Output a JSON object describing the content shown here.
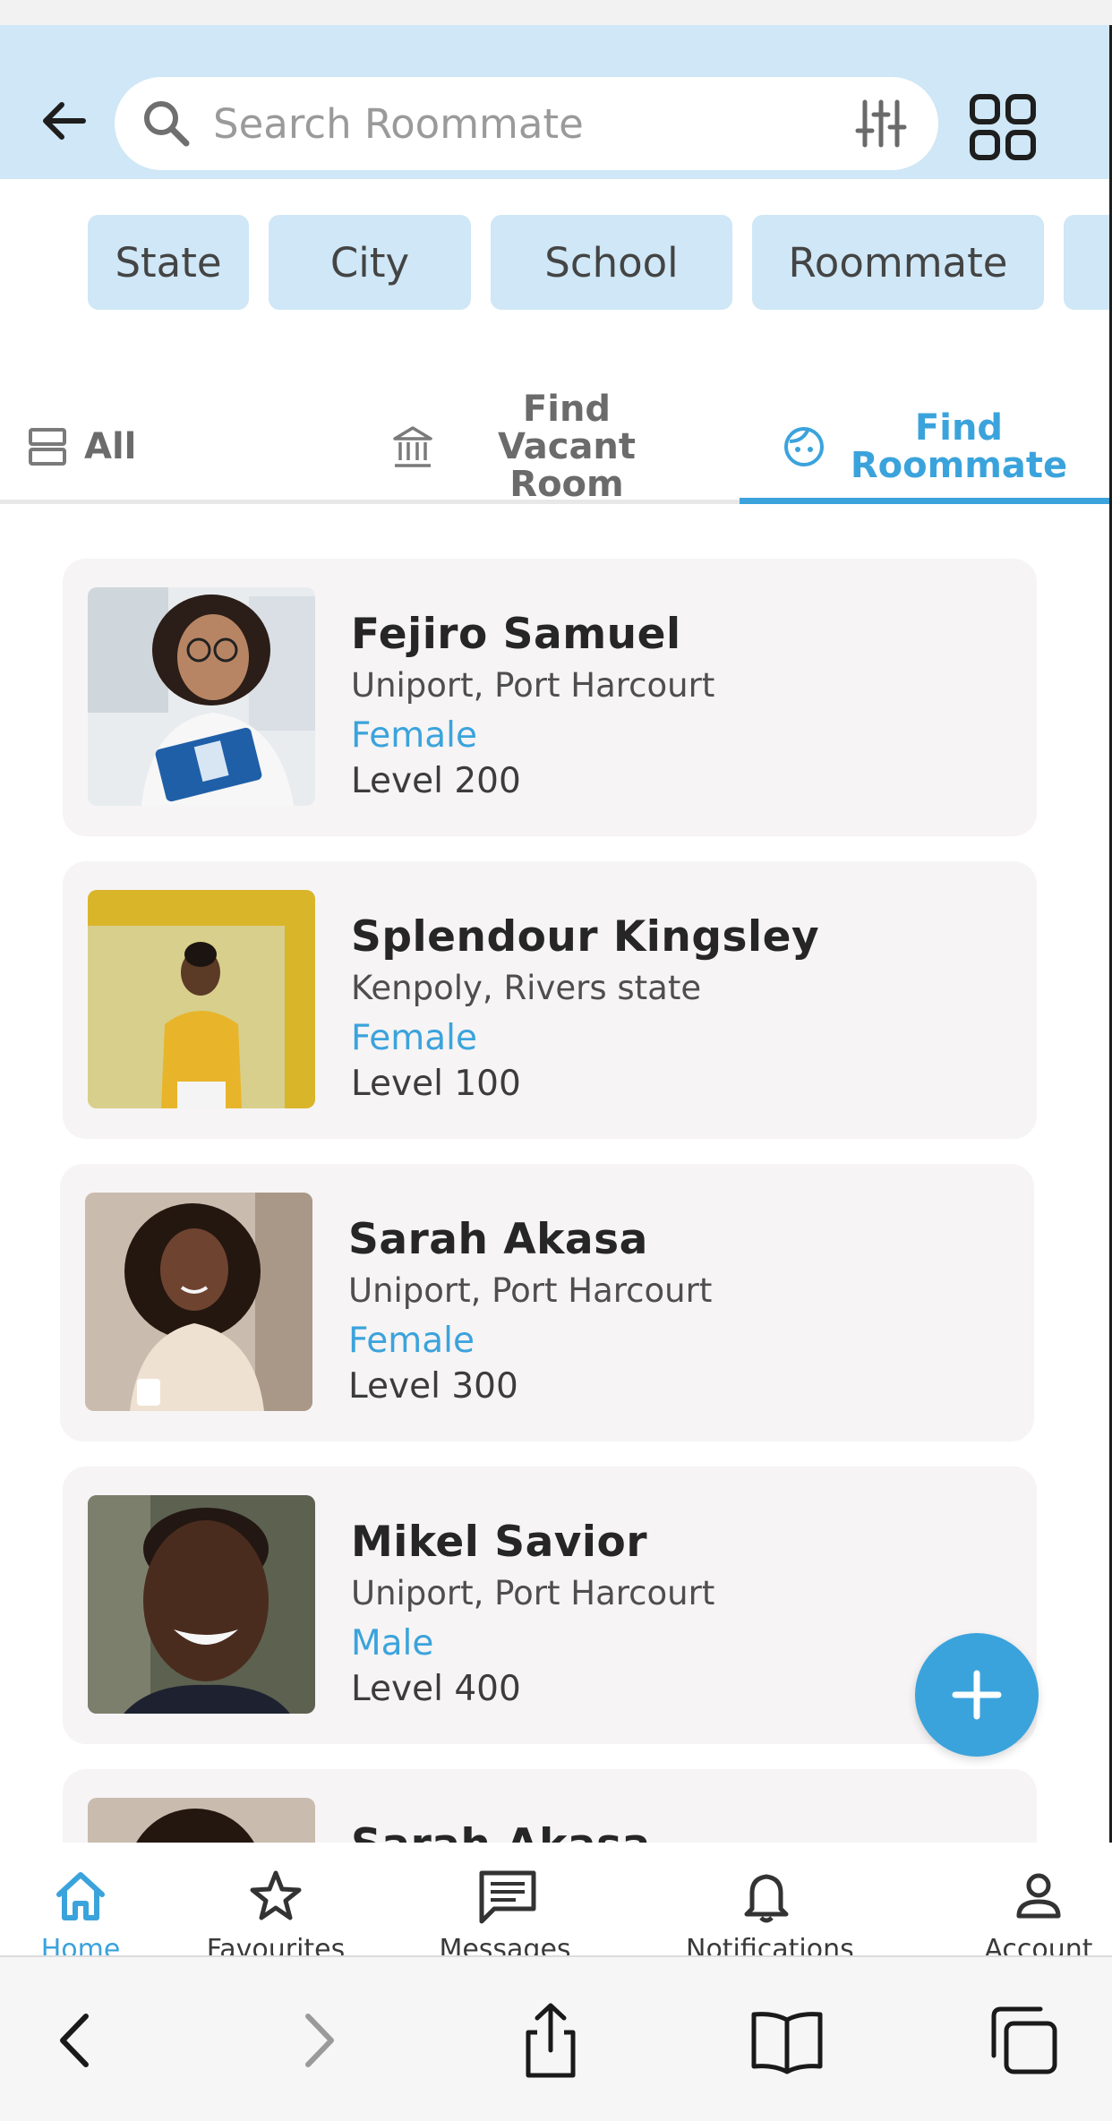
{
  "header": {
    "back_icon": "arrow-left-icon",
    "search_placeholder": "Search Roommate",
    "search_value": "",
    "filter_icon": "sliders-icon",
    "grid_icon": "grid-icon"
  },
  "chips": [
    "State",
    "City",
    "School",
    "Roommate"
  ],
  "tabs": [
    {
      "label": "All",
      "icon": "list-icon",
      "active": false
    },
    {
      "label": "Find Vacant Room",
      "icon": "bank-icon",
      "active": false
    },
    {
      "label": "Find Roommate",
      "icon": "face-icon",
      "active": true
    }
  ],
  "roommates": [
    {
      "name": "Fejiro Samuel",
      "location": "Uniport, Port Harcourt",
      "gender": "Female",
      "level": "Level 200"
    },
    {
      "name": "Splendour Kingsley",
      "location": "Kenpoly, Rivers state",
      "gender": "Female",
      "level": "Level 100"
    },
    {
      "name": "Sarah Akasa",
      "location": "Uniport, Port Harcourt",
      "gender": "Female",
      "level": "Level 300"
    },
    {
      "name": "Mikel Savior",
      "location": "Uniport, Port Harcourt",
      "gender": "Male",
      "level": "Level 400"
    },
    {
      "name": "Sarah Akasa",
      "location": "",
      "gender": "",
      "level": ""
    }
  ],
  "fab_icon": "plus-icon",
  "bottom_nav": [
    {
      "label": "Home",
      "icon": "home-icon",
      "active": true
    },
    {
      "label": "Favourites",
      "icon": "star-icon",
      "active": false
    },
    {
      "label": "Messages",
      "icon": "message-icon",
      "active": false
    },
    {
      "label": "Notifications",
      "icon": "bell-icon",
      "active": false
    },
    {
      "label": "Account",
      "icon": "person-icon",
      "active": false
    }
  ],
  "browser_toolbar": [
    "back-icon",
    "forward-icon",
    "share-icon",
    "bookmarks-icon",
    "tabs-icon"
  ],
  "colors": {
    "accent": "#3ba3dc",
    "header_bg": "#cfe7f6",
    "card_bg": "#f6f4f5"
  }
}
